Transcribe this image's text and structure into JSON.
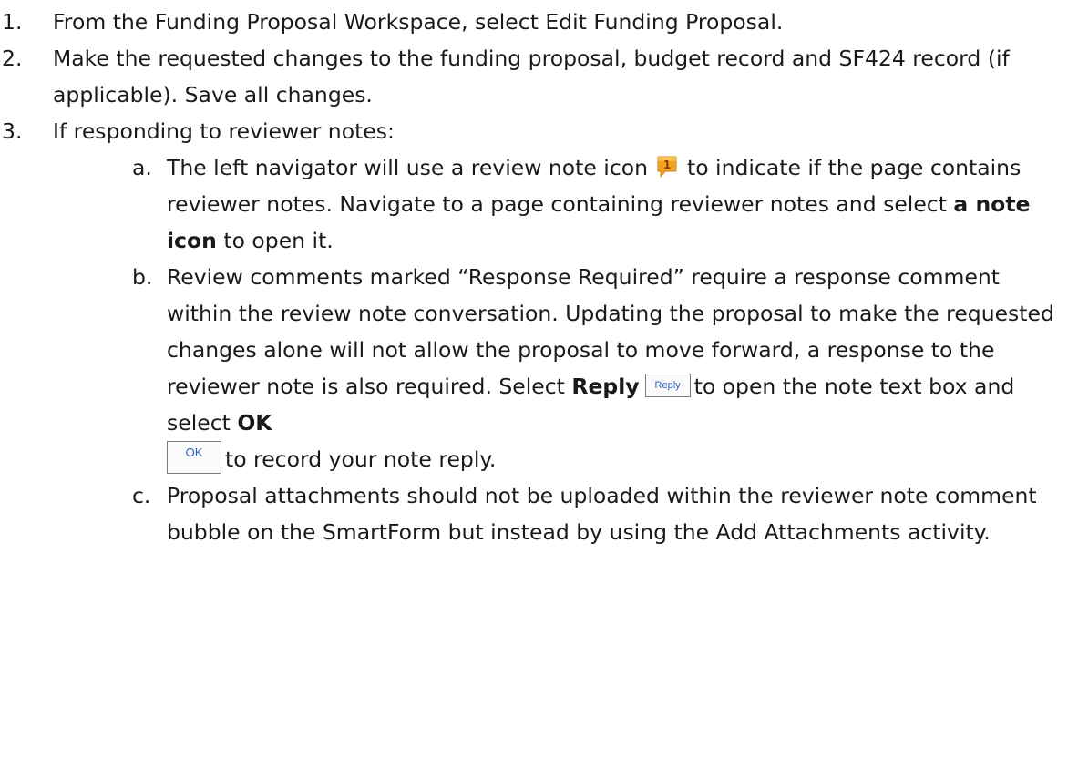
{
  "steps": [
    {
      "num": "1.",
      "text": "From the Funding Proposal Workspace, select Edit Funding Proposal."
    },
    {
      "num": "2.",
      "text": "Make the requested changes to the funding proposal, budget record and SF424 record (if applicable).  Save all changes."
    },
    {
      "num": "3.",
      "text": "If responding to reviewer notes:"
    }
  ],
  "substeps": {
    "a": {
      "num": "a.",
      "text1": "The left navigator will use a review note icon",
      "text2": "to indicate if the page contains reviewer notes. Navigate to a page containing reviewer notes and select",
      "bold": "a note icon",
      "text3": "to open it.",
      "icon_count": "1"
    },
    "b": {
      "num": "b.",
      "text1": "Review comments marked “Response Required” require a response comment within the review note conversation. Updating the proposal to make the requested changes alone will not allow the proposal to move forward, a response to the reviewer note is also required. Select",
      "bold_reply": "Reply",
      "reply_button": "Reply",
      "text2": "to open the note text box and select",
      "bold_ok": "OK",
      "ok_button": "OK",
      "text3": "to record your note reply."
    },
    "c": {
      "num": "c.",
      "text": "Proposal attachments should not be uploaded within the reviewer note comment bubble on the SmartForm but instead by using the Add Attachments activity."
    }
  },
  "colors": {
    "text": "#1a1a1a",
    "note_icon": "#f0a020",
    "button_text": "#2a63b8"
  }
}
